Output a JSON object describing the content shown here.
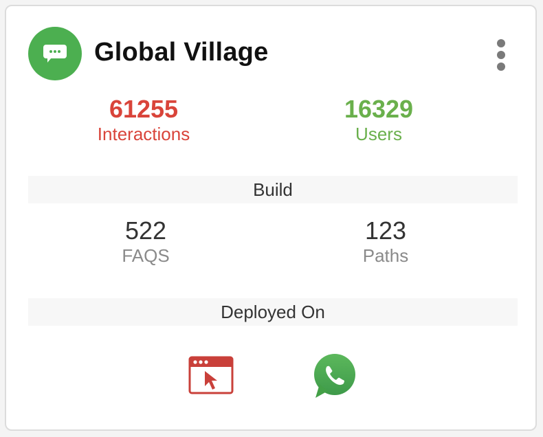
{
  "bot": {
    "name": "Global Village",
    "avatar_icon": "chat-bubble-icon",
    "avatar_color": "#4caf50"
  },
  "stats": {
    "interactions": {
      "value": "61255",
      "label": "Interactions",
      "color": "#d9443a"
    },
    "users": {
      "value": "16329",
      "label": "Users",
      "color": "#6ab04c"
    }
  },
  "build": {
    "title": "Build",
    "faqs": {
      "value": "522",
      "label": "FAQS"
    },
    "paths": {
      "value": "123",
      "label": "Paths"
    }
  },
  "deployed": {
    "title": "Deployed On",
    "channels": [
      {
        "name": "web",
        "icon": "browser-window-cursor-icon",
        "color": "#c9403a"
      },
      {
        "name": "whatsapp",
        "icon": "whatsapp-icon",
        "color": "#4caf50"
      }
    ]
  }
}
